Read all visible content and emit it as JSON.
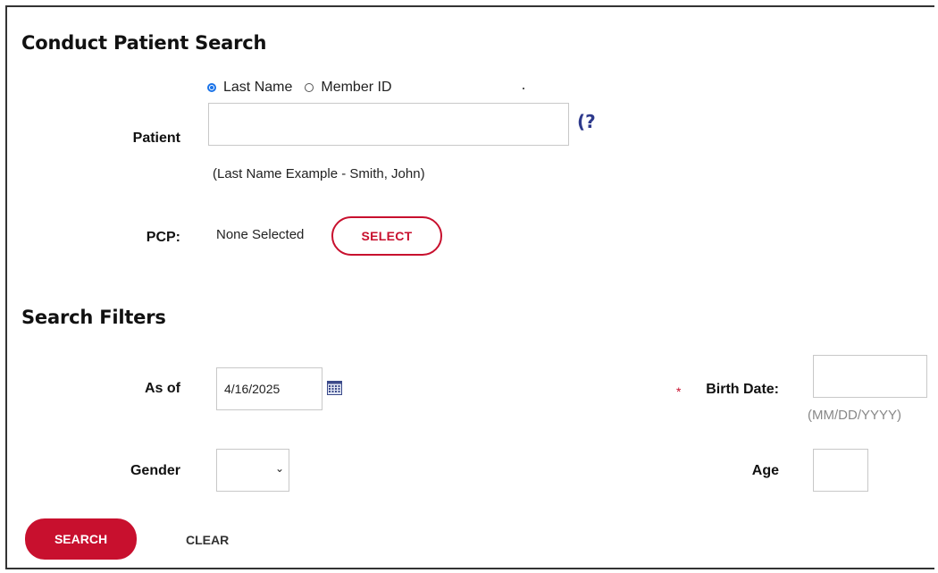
{
  "search": {
    "heading": "Conduct Patient Search",
    "radio_options": [
      "Last Name",
      "Member ID"
    ],
    "selected_option": "Last Name",
    "patient_label": "Patient",
    "patient_value": "",
    "patient_hint": "(Last Name Example - Smith, John)",
    "help_icon": "help-circle-icon",
    "pcp_label": "PCP:",
    "pcp_value": "None Selected",
    "select_button": "SELECT"
  },
  "filters": {
    "heading": "Search Filters",
    "as_of_label": "As of",
    "as_of_value": "4/16/2025",
    "calendar_icon": "calendar-icon",
    "birth_date_label": "Birth Date:",
    "required_marker": "*",
    "birth_date_value": "",
    "birth_date_format": "(MM/DD/YYYY)",
    "gender_label": "Gender",
    "gender_value": "",
    "age_label": "Age",
    "age_value": ""
  },
  "actions": {
    "search_button": "SEARCH",
    "clear_button": "CLEAR"
  },
  "colors": {
    "accent": "#c8102e",
    "radio_selected": "#1a73e8",
    "help_icon": "#2e3a8c"
  }
}
